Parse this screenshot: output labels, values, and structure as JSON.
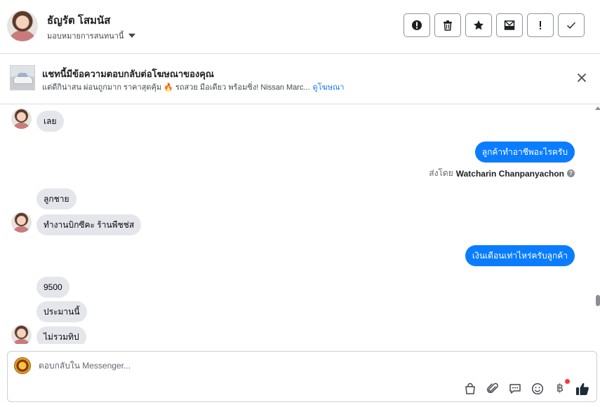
{
  "header": {
    "contact_name": "ธัญรัต โสมนัส",
    "assign_label": "มอบหมายการสนทนานี้",
    "actions": [
      {
        "icon": "alert-circle-icon"
      },
      {
        "icon": "trash-icon"
      },
      {
        "icon": "star-icon"
      },
      {
        "icon": "mark-unread-icon"
      },
      {
        "icon": "exclamation-icon"
      },
      {
        "icon": "check-icon"
      }
    ]
  },
  "banner": {
    "title": "แชทนี้มีข้อความตอบกลับต่อโฆษณาของคุณ",
    "text": "แต่ดีกิน่าสน ผ่อนถูกมาก ราคาสุดคุ้ม 🔥 รถสวย มือเดียว พร้อมซิ่ง! Nissan Marc...",
    "link": "ดูโฆษณา"
  },
  "messages": [
    {
      "side": "in",
      "text": "เลย"
    },
    {
      "side": "out",
      "text": "ลูกค้าทำอาชีพอะไรครับ"
    },
    {
      "side": "sent-by",
      "prefix": "ส่งโดย",
      "name": "Watcharin Chanpanyachon"
    },
    {
      "side": "in",
      "text": "ลูกชาย"
    },
    {
      "side": "in",
      "text": "ทำงานบิกซีคะ ร้านพืชช่ส"
    },
    {
      "side": "out",
      "text": "เงินเดือนเท่าไหร่ครับลูกค้า"
    },
    {
      "side": "in",
      "text": "9500"
    },
    {
      "side": "in",
      "text": "ประมานนี้"
    },
    {
      "side": "in",
      "text": "ไม่รวมทิป"
    }
  ],
  "composer": {
    "placeholder": "ตอบกลับใน Messenger...",
    "tools": [
      "shopping-bag-icon",
      "attachment-icon",
      "saved-replies-icon",
      "emoji-icon",
      "baht-icon",
      "like-icon"
    ],
    "baht_symbol": "฿"
  },
  "colors": {
    "outgoing_bubble": "#0a7cff",
    "incoming_bubble": "#e4e6eb",
    "link": "#1877f2"
  }
}
